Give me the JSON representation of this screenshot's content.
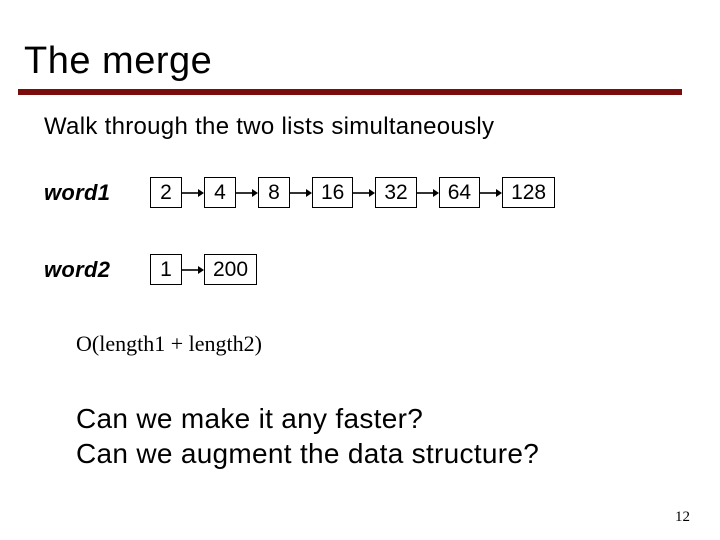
{
  "title": "The merge",
  "subtitle": "Walk through the two lists simultaneously",
  "rows": {
    "word1": {
      "label": "word1",
      "values": [
        "2",
        "4",
        "8",
        "16",
        "32",
        "64",
        "128"
      ]
    },
    "word2": {
      "label": "word2",
      "values": [
        "1",
        "200"
      ]
    }
  },
  "complexity": "O(length1 + length2)",
  "question1": "Can we make it any faster?",
  "question2": "Can we augment the data structure?",
  "page_number": "12"
}
